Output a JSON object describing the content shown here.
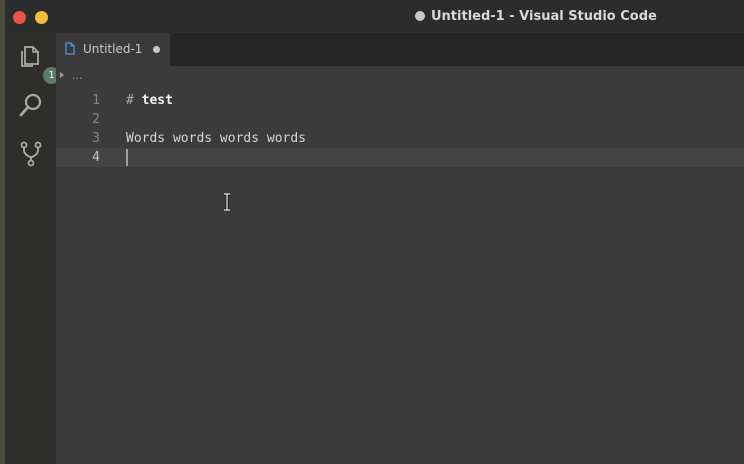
{
  "window": {
    "title": "Untitled-1 - Visual Studio Code",
    "dirty": true
  },
  "activity_bar": {
    "items": [
      {
        "name": "explorer",
        "icon": "files-icon",
        "badge": "1"
      },
      {
        "name": "search",
        "icon": "search-icon"
      },
      {
        "name": "source-control",
        "icon": "git-branch-icon"
      }
    ]
  },
  "tabs": [
    {
      "label": "Untitled-1",
      "icon": "file-icon",
      "dirty": true,
      "active": true
    }
  ],
  "breadcrumb": {
    "text": "..."
  },
  "editor": {
    "lines": [
      {
        "number": "1",
        "hash": "#",
        "heading": "test",
        "text": ""
      },
      {
        "number": "2",
        "text": ""
      },
      {
        "number": "3",
        "text": "Words words words words"
      },
      {
        "number": "4",
        "text": "",
        "current": true
      }
    ]
  },
  "colors": {
    "close_button": "#e9554b",
    "minimize_button": "#f2bd3a",
    "badge": "#5b7c62",
    "editor_background": "#3b3b3b"
  }
}
